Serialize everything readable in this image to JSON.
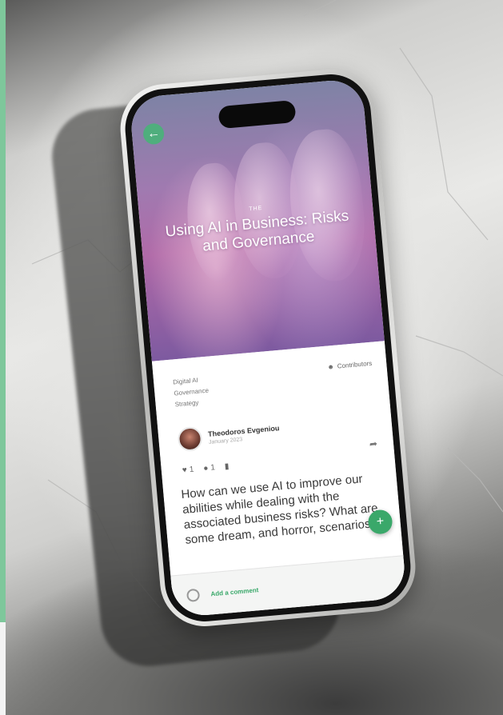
{
  "article": {
    "kicker": "THE",
    "title": "Using AI in Business: Risks and Governance",
    "tags": [
      "Digital AI",
      "Governance",
      "Strategy"
    ],
    "contributors_label": "Contributors"
  },
  "author": {
    "name": "Theodoros Evgeniou",
    "date": "January 2023"
  },
  "actions": {
    "likes": "1",
    "comments": "1"
  },
  "question": "How can we use AI to improve our abilities while dealing with the associated business risks? What are some dream, and horror, scenarios",
  "comment_bar": {
    "placeholder": "Add a comment"
  },
  "colors": {
    "accent": "#3aa86a",
    "left_strip": "#7ec79b"
  }
}
